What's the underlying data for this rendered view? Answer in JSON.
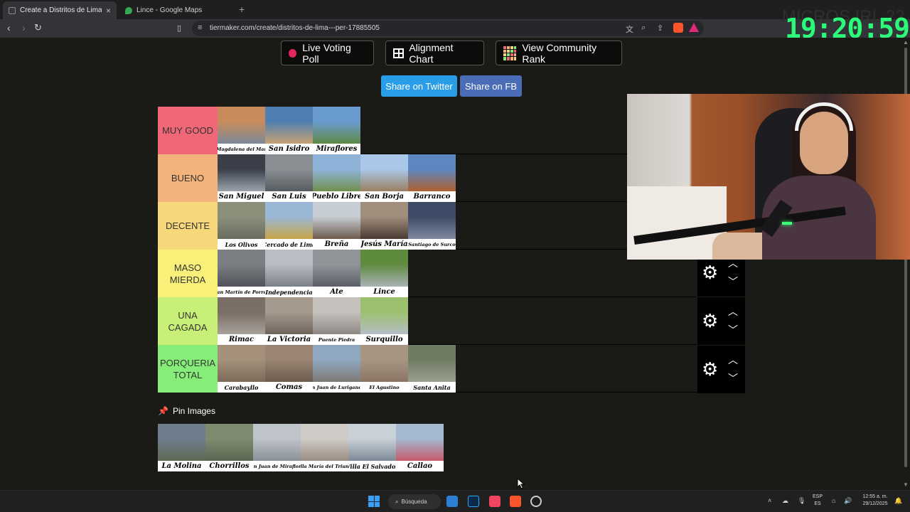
{
  "browser": {
    "tabs": [
      {
        "label": "Create a Distritos de Lima - Peru",
        "active": true
      },
      {
        "label": "Lince - Google Maps",
        "active": false
      }
    ],
    "url": "tiermaker.com/create/distritos-de-lima---per-17885505",
    "new_tab": "+"
  },
  "overlay": {
    "clock": "19:20:59",
    "ghost_title": "MICROS IRL 22"
  },
  "toolbar_buttons": {
    "live_voting": "Live Voting Poll",
    "alignment": "Alignment Chart",
    "community": "View Community Rank"
  },
  "share": {
    "twitter": "Share on Twitter",
    "fb": "Share on FB",
    "twitter_color": "#2a9de8",
    "fb_color": "#4b6cb7"
  },
  "tiers": [
    {
      "label": "MUY GOOD",
      "color": "#f06878",
      "items": [
        {
          "name": "Magdalena del Mar",
          "size": "sm",
          "colors": [
            "#c98b5a",
            "#7c8a9a"
          ]
        },
        {
          "name": "San Isidro",
          "size": "",
          "colors": [
            "#4f7fb0",
            "#c8a274"
          ]
        },
        {
          "name": "Miraflores",
          "size": "",
          "colors": [
            "#6a9bd0",
            "#5e8a45"
          ]
        }
      ]
    },
    {
      "label": "BUENO",
      "color": "#f4b37a",
      "items": [
        {
          "name": "San Miguel",
          "size": "",
          "colors": [
            "#3a3f4a",
            "#9aa3ad"
          ]
        },
        {
          "name": "San Luis",
          "size": "",
          "colors": [
            "#8a8f94",
            "#575c61"
          ]
        },
        {
          "name": "Pueblo Libre",
          "size": "",
          "colors": [
            "#8fb3d8",
            "#6f8f4c"
          ]
        },
        {
          "name": "San Borja",
          "size": "",
          "colors": [
            "#a9c7e8",
            "#9c7f62"
          ]
        },
        {
          "name": "Barranco",
          "size": "",
          "colors": [
            "#5d87c2",
            "#b0602e"
          ]
        }
      ]
    },
    {
      "label": "DECENTE",
      "color": "#f6d77a",
      "items": [
        {
          "name": "Los Olivos",
          "size": "md",
          "colors": [
            "#8c8f7a",
            "#6a6c60"
          ]
        },
        {
          "name": "Cercado de Lima",
          "size": "md",
          "colors": [
            "#9ab7d6",
            "#c8a448"
          ]
        },
        {
          "name": "Breña",
          "size": "",
          "colors": [
            "#c7cdd4",
            "#6b5a4c"
          ]
        },
        {
          "name": "Jesús María",
          "size": "",
          "colors": [
            "#a08d7c",
            "#4a3a33"
          ]
        },
        {
          "name": "Santiago de Surco",
          "size": "sm",
          "colors": [
            "#3e4a66",
            "#7f8aa0"
          ]
        }
      ]
    },
    {
      "label": "MASO MIERDA",
      "color": "#f8f078",
      "items": [
        {
          "name": "San Martín de Porres",
          "size": "sm",
          "colors": [
            "#7b7f83",
            "#50545a"
          ]
        },
        {
          "name": "Independencia",
          "size": "md",
          "colors": [
            "#b9bec4",
            "#7b8086"
          ]
        },
        {
          "name": "Ate",
          "size": "",
          "colors": [
            "#8f9499",
            "#5c6066"
          ]
        },
        {
          "name": "Lince",
          "size": "",
          "colors": [
            "#5f8b3e",
            "#a9b1b7"
          ]
        }
      ]
    },
    {
      "label": "UNA CAGADA",
      "color": "#c8f078",
      "items": [
        {
          "name": "Rimac",
          "size": "",
          "colors": [
            "#7a6e66",
            "#a8a29a"
          ]
        },
        {
          "name": "La Victoria",
          "size": "",
          "colors": [
            "#a69a8e",
            "#6e645a"
          ]
        },
        {
          "name": "Puente Piedra",
          "size": "sm",
          "colors": [
            "#c5c1bd",
            "#8d8883"
          ]
        },
        {
          "name": "Surquillo",
          "size": "",
          "colors": [
            "#9dc06e",
            "#b5bec6"
          ]
        }
      ]
    },
    {
      "label": "PORQUERIA TOTAL",
      "color": "#86ee78",
      "items": [
        {
          "name": "Carabayllo",
          "size": "md",
          "colors": [
            "#a5917b",
            "#7b6a58"
          ]
        },
        {
          "name": "Comas",
          "size": "",
          "colors": [
            "#9a8573",
            "#6c5c4e"
          ]
        },
        {
          "name": "San Juan de Lurigancho",
          "size": "sm",
          "colors": [
            "#8fa8c0",
            "#7d7a75"
          ]
        },
        {
          "name": "El Agustino",
          "size": "sm",
          "colors": [
            "#a89483",
            "#8b7665"
          ]
        },
        {
          "name": "Santa Anita",
          "size": "md",
          "colors": [
            "#6f7b63",
            "#9ba08e"
          ]
        }
      ]
    }
  ],
  "pin": {
    "title": "Pin Images",
    "items": [
      {
        "name": "La Molina",
        "size": "",
        "colors": [
          "#6f7d8c",
          "#5d6a55"
        ]
      },
      {
        "name": "Chorrillos",
        "size": "",
        "colors": [
          "#7f8b70",
          "#5a6650"
        ]
      },
      {
        "name": "San Juan de Miraflores",
        "size": "sm",
        "colors": [
          "#bfc4ca",
          "#8a9097"
        ]
      },
      {
        "name": "Villa María del Triunfo",
        "size": "sm",
        "colors": [
          "#cfcbc6",
          "#9a8e82"
        ]
      },
      {
        "name": "Villa El Salvador",
        "size": "md",
        "colors": [
          "#c9d1d8",
          "#7d8a96"
        ]
      },
      {
        "name": "Callao",
        "size": "",
        "colors": [
          "#a4b9cf",
          "#c45a6a"
        ]
      }
    ]
  },
  "taskbar": {
    "search": "Búsqueda",
    "lang_top": "ESP",
    "lang_bottom": "ES",
    "time": "12:55 a. m.",
    "date": "29/12/2025"
  }
}
